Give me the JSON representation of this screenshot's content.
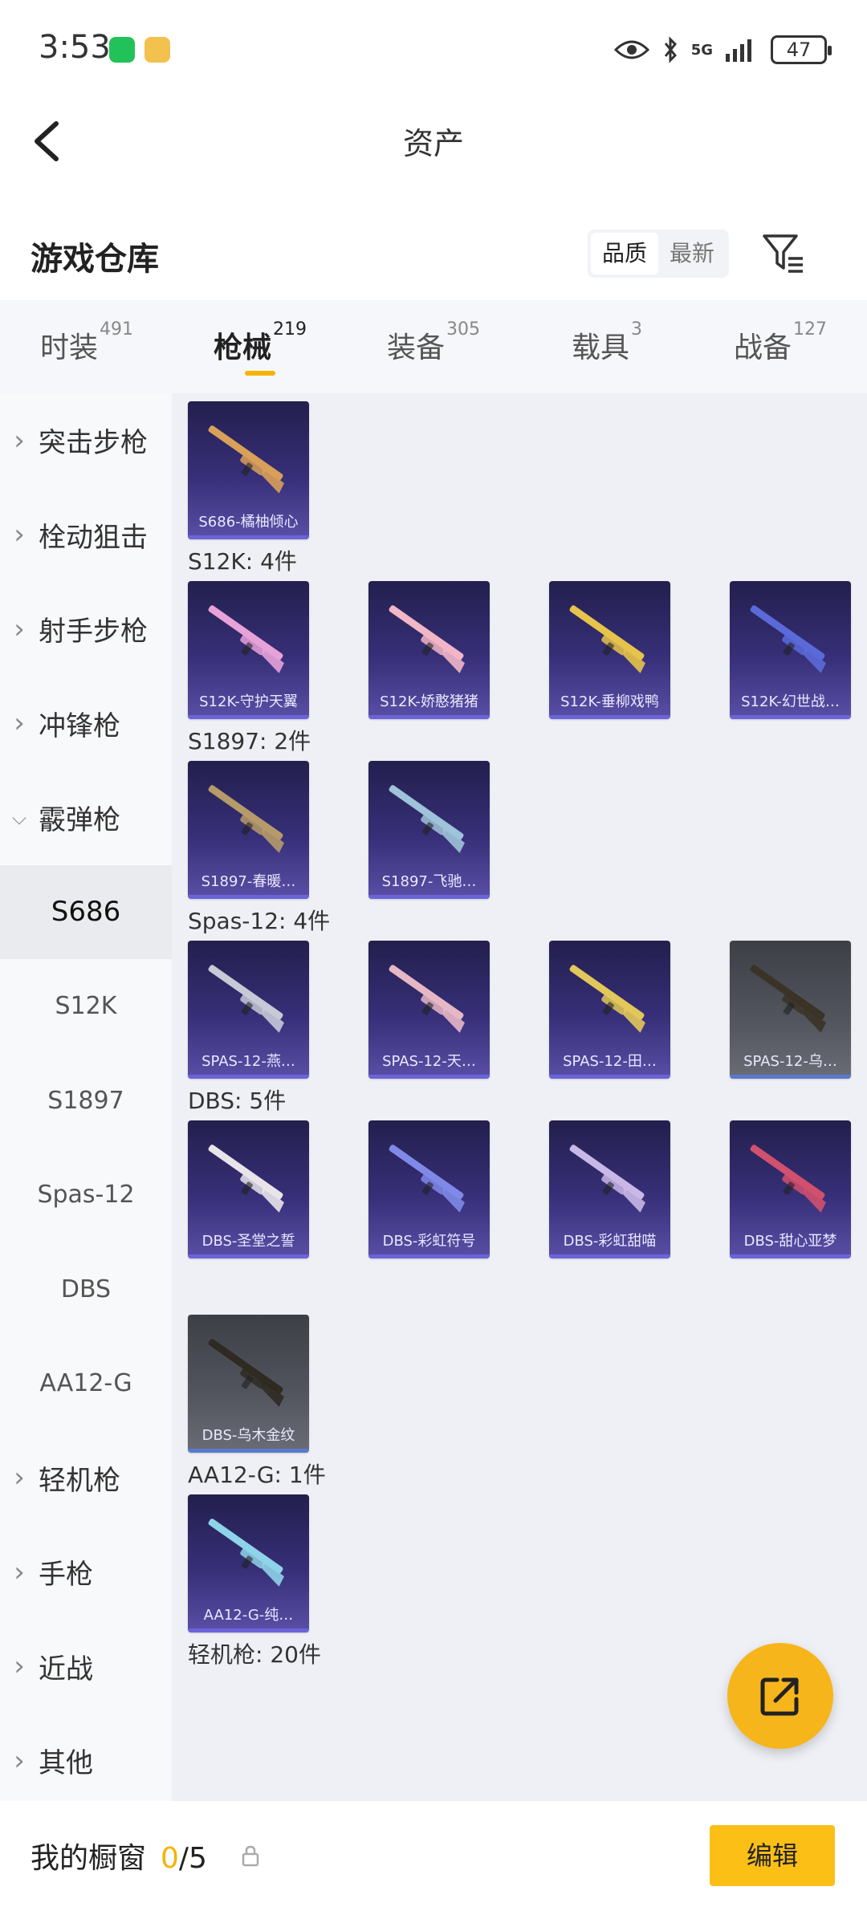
{
  "status_bar": {
    "time": "3:53",
    "battery": "47",
    "network": "5G"
  },
  "header": {
    "title": "资产"
  },
  "warehouse": {
    "title": "游戏仓库",
    "sort_options": [
      "品质",
      "最新"
    ],
    "sort_selected": "品质"
  },
  "tabs": [
    {
      "label": "时装",
      "count": "491"
    },
    {
      "label": "枪械",
      "count": "219",
      "active": true
    },
    {
      "label": "装备",
      "count": "305"
    },
    {
      "label": "载具",
      "count": "3"
    },
    {
      "label": "战备",
      "count": "127"
    }
  ],
  "sidebar": {
    "items": [
      {
        "label": "突击步枪",
        "expanded": false
      },
      {
        "label": "栓动狙击",
        "expanded": false
      },
      {
        "label": "射手步枪",
        "expanded": false
      },
      {
        "label": "冲锋枪",
        "expanded": false
      },
      {
        "label": "霰弹枪",
        "expanded": true
      },
      {
        "label": "S686",
        "sub": true,
        "selected": true
      },
      {
        "label": "S12K",
        "sub": true
      },
      {
        "label": "S1897",
        "sub": true
      },
      {
        "label": "Spas-12",
        "sub": true
      },
      {
        "label": "DBS",
        "sub": true
      },
      {
        "label": "AA12-G",
        "sub": true
      },
      {
        "label": "轻机枪",
        "expanded": false
      },
      {
        "label": "手枪",
        "expanded": false
      },
      {
        "label": "近战",
        "expanded": false
      },
      {
        "label": "其他",
        "expanded": false
      }
    ]
  },
  "groups": [
    {
      "title": "",
      "items": [
        {
          "name": "S686-橘柚倾心",
          "color": "#d9a05a"
        }
      ]
    },
    {
      "title": "S12K: 4件",
      "items": [
        {
          "name": "S12K-守护天翼",
          "color": "#e7a2d8"
        },
        {
          "name": "S12K-娇憨猪猪",
          "color": "#f2b6c6"
        },
        {
          "name": "S12K-垂柳戏鸭",
          "color": "#e6c34a"
        },
        {
          "name": "S12K-幻世战…",
          "color": "#5b6ad9"
        }
      ]
    },
    {
      "title": "S1897: 2件",
      "items": [
        {
          "name": "S1897-春暖…",
          "color": "#b59a6a"
        },
        {
          "name": "S1897-飞驰…",
          "color": "#9fc3d9"
        }
      ]
    },
    {
      "title": "Spas-12: 4件",
      "items": [
        {
          "name": "SPAS-12-燕…",
          "color": "#c7c9d6"
        },
        {
          "name": "SPAS-12-天…",
          "color": "#e7b7c6"
        },
        {
          "name": "SPAS-12-田…",
          "color": "#e2c85a"
        },
        {
          "name": "SPAS-12-乌…",
          "color": "#3a3326",
          "grey": true
        }
      ]
    },
    {
      "title": "DBS: 5件",
      "items": [
        {
          "name": "DBS-圣堂之誓",
          "color": "#e9e4ea"
        },
        {
          "name": "DBS-彩虹符号",
          "color": "#7f8ae8"
        },
        {
          "name": "DBS-彩虹甜喵",
          "color": "#c9b7e6"
        },
        {
          "name": "DBS-甜心亚梦",
          "color": "#d1506d"
        },
        {
          "name": "DBS-乌木金纹",
          "color": "#2f2a22",
          "grey": true
        }
      ]
    },
    {
      "title": "AA12-G: 1件",
      "items": [
        {
          "name": "AA12-G-纯…",
          "color": "#8fd3e8"
        }
      ]
    },
    {
      "title": "轻机枪: 20件",
      "items": []
    }
  ],
  "bottom_bar": {
    "label": "我的橱窗",
    "current": "0",
    "total": "/5",
    "edit_label": "编辑"
  },
  "colors": {
    "accent": "#f5b300",
    "card_bg": "#372f78",
    "panel_bg": "#eef0f5"
  }
}
